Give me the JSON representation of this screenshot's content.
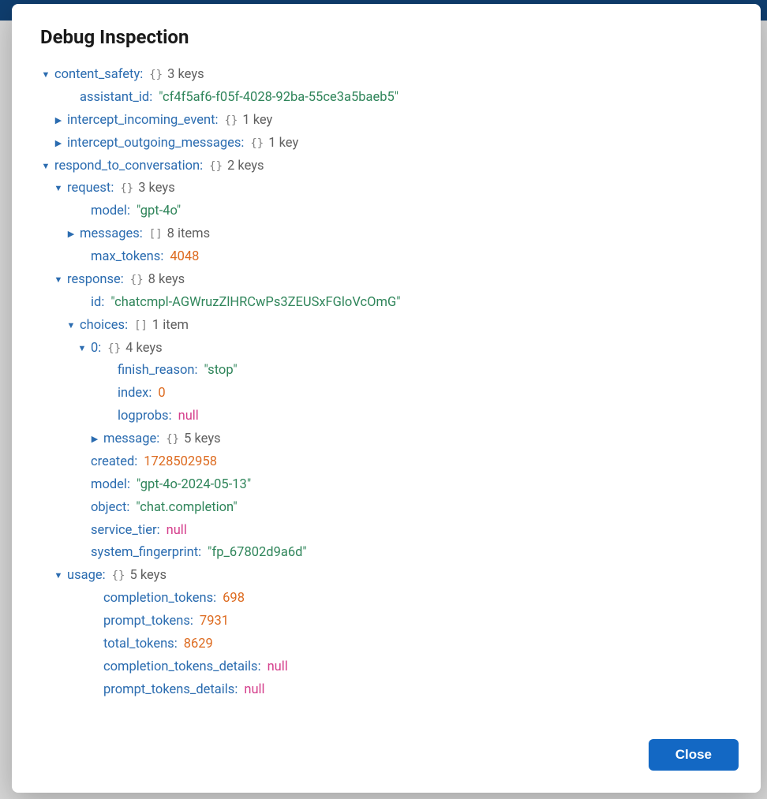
{
  "modal": {
    "title": "Debug Inspection",
    "close_label": "Close"
  },
  "tree": {
    "content_safety": {
      "summary": "3 keys",
      "assistant_id": "cf4f5af6-f05f-4028-92ba-55ce3a5baeb5",
      "intercept_incoming_event": {
        "summary": "1 key"
      },
      "intercept_outgoing_messages": {
        "summary": "1 key"
      }
    },
    "respond_to_conversation": {
      "summary": "2 keys",
      "request": {
        "summary": "3 keys",
        "model": "gpt-4o",
        "messages": {
          "summary": "8 items"
        },
        "max_tokens": 4048
      },
      "response": {
        "summary": "8 keys",
        "id": "chatcmpl-AGWruzZlHRCwPs3ZEUSxFGloVcOmG",
        "choices": {
          "summary": "1 item",
          "item0": {
            "summary": "4 keys",
            "finish_reason": "stop",
            "index": 0,
            "logprobs": "null",
            "message": {
              "summary": "5 keys"
            }
          }
        },
        "created": 1728502958,
        "model": "gpt-4o-2024-05-13",
        "object": "chat.completion",
        "service_tier": "null",
        "system_fingerprint": "fp_67802d9a6d"
      },
      "usage": {
        "summary": "5 keys",
        "completion_tokens": 698,
        "prompt_tokens": 7931,
        "total_tokens": 8629,
        "completion_tokens_details": "null",
        "prompt_tokens_details": "null"
      }
    }
  },
  "labels": {
    "content_safety": "content_safety",
    "assistant_id": "assistant_id",
    "intercept_incoming_event": "intercept_incoming_event",
    "intercept_outgoing_messages": "intercept_outgoing_messages",
    "respond_to_conversation": "respond_to_conversation",
    "request": "request",
    "model": "model",
    "messages": "messages",
    "max_tokens": "max_tokens",
    "response": "response",
    "id": "id",
    "choices": "choices",
    "item0": "0",
    "finish_reason": "finish_reason",
    "index": "index",
    "logprobs": "logprobs",
    "message": "message",
    "created": "created",
    "object": "object",
    "service_tier": "service_tier",
    "system_fingerprint": "system_fingerprint",
    "usage": "usage",
    "completion_tokens": "completion_tokens",
    "prompt_tokens": "prompt_tokens",
    "total_tokens": "total_tokens",
    "completion_tokens_details": "completion_tokens_details",
    "prompt_tokens_details": "prompt_tokens_details"
  },
  "badge": {
    "obj": "{}",
    "arr": "[]"
  }
}
